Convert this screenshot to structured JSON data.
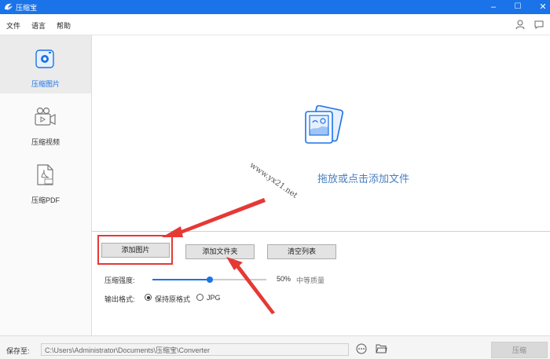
{
  "app": {
    "title": "压缩宝",
    "accent": "#1a73e8"
  },
  "window_controls": {
    "minimize": "–",
    "maximize": "☐",
    "close": "✕"
  },
  "menu": {
    "items": [
      "文件",
      "语言",
      "帮助"
    ]
  },
  "sidebar": {
    "items": [
      {
        "label": "压缩图片",
        "icon": "image-compress-icon",
        "active": true
      },
      {
        "label": "压缩视频",
        "icon": "video-camera-icon",
        "active": false
      },
      {
        "label": "压缩PDF",
        "icon": "pdf-file-icon",
        "active": false
      }
    ]
  },
  "drop_zone": {
    "text": "拖放或点击添加文件",
    "icon": "image-stack-icon"
  },
  "buttons": {
    "add_image": "添加图片",
    "add_folder": "添加文件夹",
    "clear_list": "清空列表"
  },
  "compression": {
    "label": "压缩强度:",
    "value_percent": 50,
    "value_text": "50%",
    "quality_text": "中等质量"
  },
  "output_format": {
    "label": "输出格式:",
    "options": [
      "保持原格式",
      "JPG"
    ],
    "selected": "保持原格式"
  },
  "footer": {
    "save_label": "保存至:",
    "path": "C:\\Users\\Administrator\\Documents\\压缩宝\\Converter",
    "compress_label": "压缩"
  },
  "watermark": {
    "text": "www.yx21.net"
  },
  "colors": {
    "annotation_red": "#e53935",
    "sidebar_active": "#ebebeb"
  }
}
